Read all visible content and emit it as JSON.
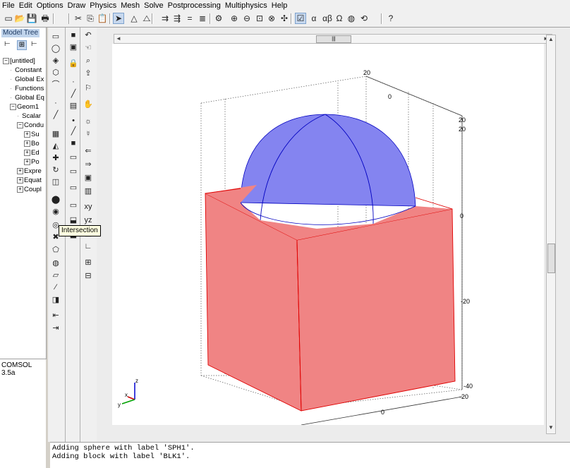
{
  "menu": [
    "File",
    "Edit",
    "Options",
    "Draw",
    "Physics",
    "Mesh",
    "Solve",
    "Postprocessing",
    "Multiphysics",
    "Help"
  ],
  "toolbar": {
    "icons": [
      "new-file-icon",
      "open-file-icon",
      "save-icon",
      "print-icon",
      "cut-icon",
      "copy-icon",
      "paste-icon",
      "select-icon",
      "triangle-icon",
      "delta-icon",
      "array-icon",
      "align-icon",
      "equals-icon",
      "list-icon",
      "gear-icon",
      "zoom-in-icon",
      "zoom-out-icon",
      "zoom-window-icon",
      "zoom-extents-icon",
      "node-icon",
      "grid-icon",
      "alpha-icon",
      "alpha-beta-icon",
      "omega-icon",
      "sphere-tool-icon",
      "plot-icon",
      "help-icon"
    ]
  },
  "tree": {
    "title": "Model Tree",
    "items": [
      {
        "label": "[untitled]",
        "pm": "−"
      },
      {
        "label": "Constant",
        "pm": ""
      },
      {
        "label": "Global Ex",
        "pm": ""
      },
      {
        "label": "Functions",
        "pm": ""
      },
      {
        "label": "Global Eq",
        "pm": ""
      },
      {
        "label": "Geom1",
        "pm": "−"
      },
      {
        "label": "Scalar",
        "pm": ""
      },
      {
        "label": "Condu",
        "pm": "−"
      },
      {
        "label": "Su",
        "pm": "+"
      },
      {
        "label": "Bo",
        "pm": "+"
      },
      {
        "label": "Ed",
        "pm": "+"
      },
      {
        "label": "Po",
        "pm": "+"
      },
      {
        "label": "Expre",
        "pm": "+"
      },
      {
        "label": "Equat",
        "pm": "+"
      },
      {
        "label": "Coupl",
        "pm": "+"
      }
    ]
  },
  "version": "COMSOL 3.5a",
  "tooltip": "Intersection",
  "console": [
    "Adding sphere with label 'SPH1'.",
    "Adding block with label 'BLK1'."
  ],
  "axes": {
    "top_20": "20",
    "top_0": "0",
    "right_20a": "20",
    "right_20b": "20",
    "right_0": "0",
    "right_m20": "-20",
    "bottom_m40": "-40",
    "bottom_m20": "-20",
    "bottom_0": "0",
    "triad_z": "z",
    "triad_x": "x",
    "triad_y": "y"
  },
  "colors": {
    "block": "#f08484",
    "sphere": "#8484f0",
    "block_edge": "#e00000",
    "sphere_edge": "#0000c0"
  }
}
